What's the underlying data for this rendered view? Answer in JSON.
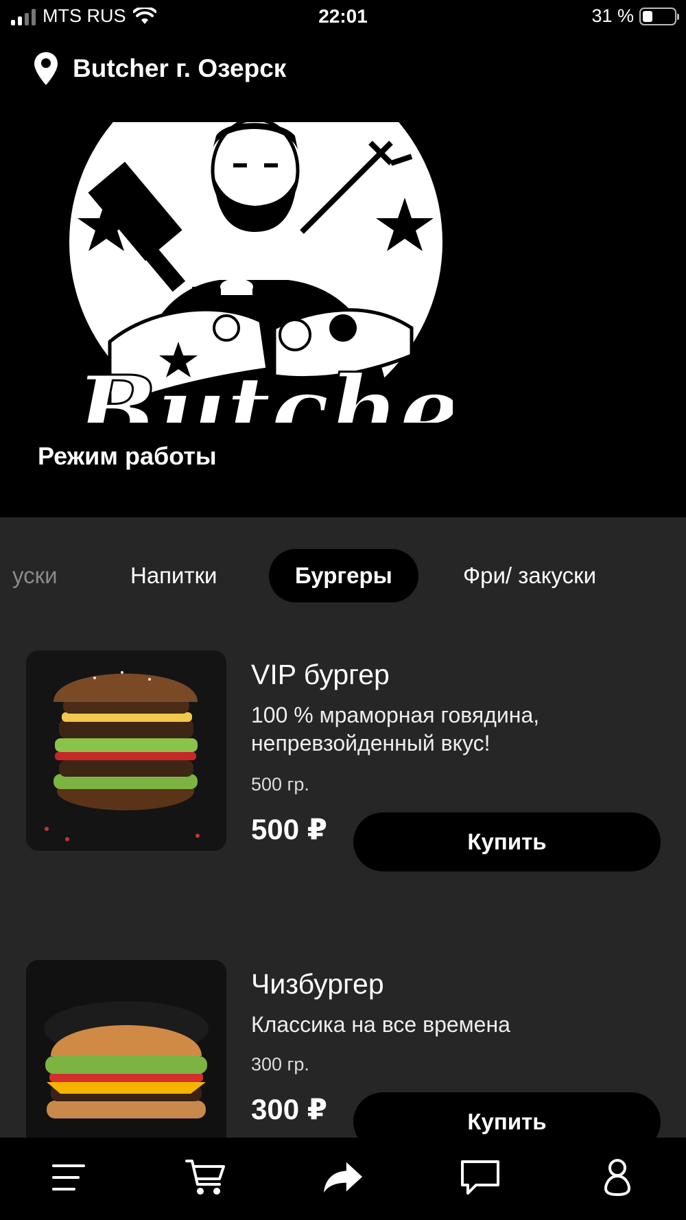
{
  "status_bar": {
    "carrier": "MTS RUS",
    "time": "22:01",
    "battery": "31 %",
    "battery_level": 0.31
  },
  "header": {
    "location": "Butcher г. Озерск",
    "logo_text": "Butcher",
    "hours_label": "Режим работы"
  },
  "tabs": [
    {
      "label": "уски",
      "state": "partial"
    },
    {
      "label": "Напитки",
      "state": "normal"
    },
    {
      "label": "Бургеры",
      "state": "active"
    },
    {
      "label": "Фри/ закуски",
      "state": "normal"
    }
  ],
  "products": [
    {
      "name": "VIP бургер",
      "description": "100 % мраморная говядина, непревзойденный вкус!",
      "weight": "500 гр.",
      "price": "500 ₽",
      "buy_label": "Купить"
    },
    {
      "name": "Чизбургер",
      "description": "Классика на все времена",
      "weight": "300 гр.",
      "price": "300 ₽",
      "buy_label": "Купить"
    }
  ],
  "bottom_nav": [
    {
      "icon": "menu-icon"
    },
    {
      "icon": "cart-icon"
    },
    {
      "icon": "share-icon"
    },
    {
      "icon": "chat-icon"
    },
    {
      "icon": "profile-icon"
    }
  ],
  "colors": {
    "background": "#000000",
    "panel": "#262626",
    "button": "#000000",
    "text": "#ffffff"
  }
}
